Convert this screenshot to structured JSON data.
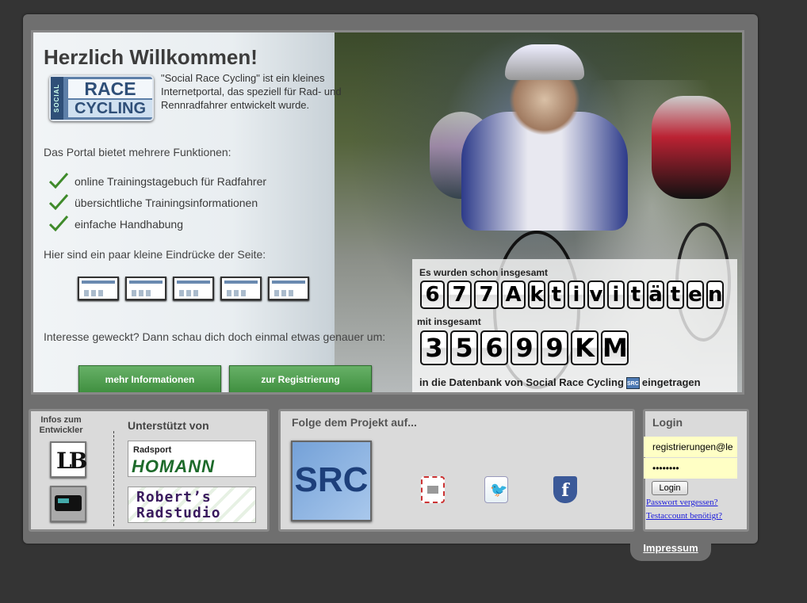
{
  "hero": {
    "title": "Herzlich Willkommen!",
    "logo_social": "SOCIAL",
    "logo_race": "RACE",
    "logo_cycling": "CYCLING",
    "intro": "\"Social Race Cycling\" ist ein kleines Internetportal, das speziell für Rad- und Rennradfahrer entwickelt wurde.",
    "functions_heading": "Das Portal bietet mehrere Funktionen:",
    "features": [
      "online Trainingstagebuch für Radfahrer",
      "übersichtliche Trainingsinformationen",
      "einfache Handhabung"
    ],
    "impressions": "Hier sind ein paar kleine Eindrücke der Seite:",
    "interest": "Interesse geweckt? Dann schau dich doch einmal etwas genauer um:",
    "btn_more": "mehr Informationen",
    "btn_register": "zur Registrierung",
    "colors": {
      "button_green": "#4f9f4f",
      "background": "#343434",
      "frame": "#6f6f6f"
    }
  },
  "stats": {
    "line1": "Es wurden schon insgesamt",
    "activities_digits": [
      "6",
      "7",
      "7",
      "A",
      "k",
      "t",
      "i",
      "v",
      "i",
      "t",
      "ä",
      "t",
      "e",
      "n"
    ],
    "line2": "mit insgesamt",
    "km_digits": [
      "3",
      "5",
      "6",
      "9",
      "9",
      "K",
      "M"
    ],
    "line3_pre": "in die Datenbank von Social Race Cycling",
    "src_mini": "SRC",
    "line3_post": "eingetragen"
  },
  "footer": {
    "dev_heading": "Infos zum Entwickler",
    "dev_logo": "LB",
    "supported_heading": "Unterstützt von",
    "sponsor1_top": "Radsport",
    "sponsor1_name": "HOMANN",
    "sponsor2_line1": "Robert’s",
    "sponsor2_line2": "Radstudio",
    "follow_heading": "Folge dem Projekt auf...",
    "src_logo": "SRC",
    "social_icons": [
      "mail-icon",
      "twitter-icon",
      "facebook-icon"
    ],
    "login_heading": "Login",
    "email_value": "registrierungen@le",
    "password_value": "••••••••",
    "login_button": "Login",
    "forgot_link": "Passwort vergessen?",
    "testaccount_link": "Testaccount benötigt?",
    "impressum": "Impressum"
  }
}
